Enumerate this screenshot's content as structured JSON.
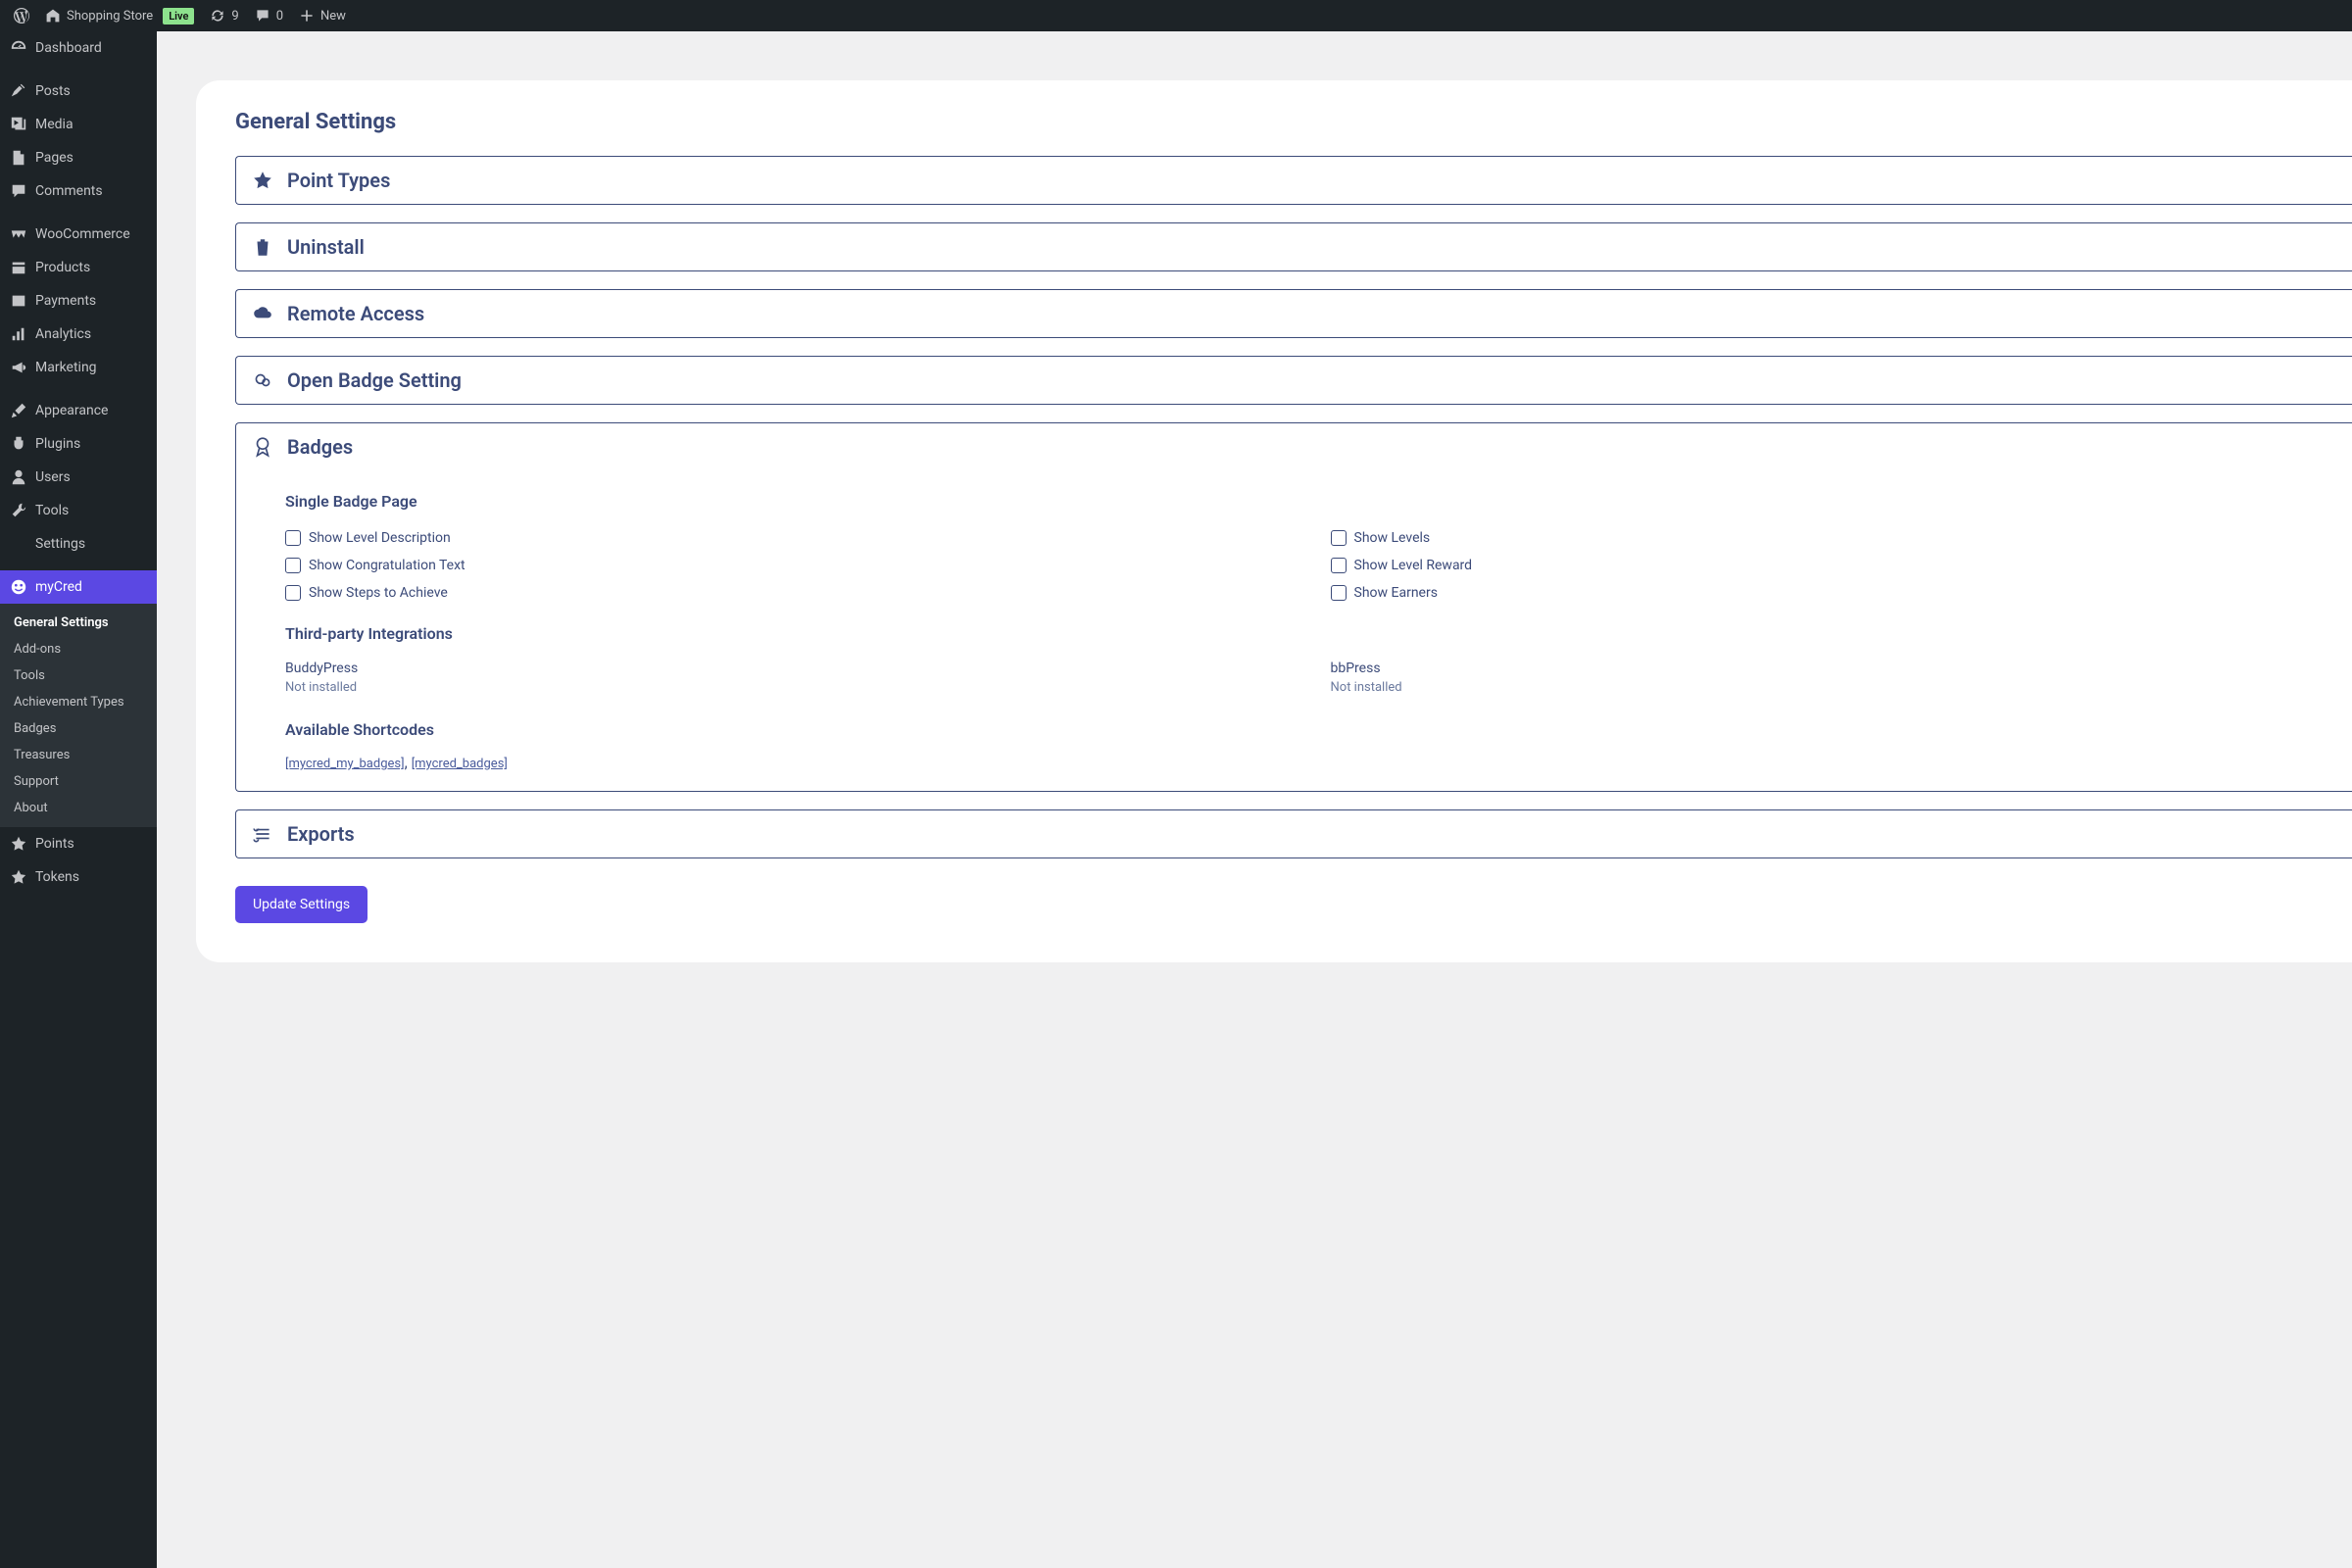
{
  "adminbar": {
    "site_name": "Shopping Store",
    "live_label": "Live",
    "updates": "9",
    "comments": "0",
    "new_label": "New"
  },
  "sidebar": {
    "items": [
      {
        "label": "Dashboard"
      },
      {
        "label": "Posts"
      },
      {
        "label": "Media"
      },
      {
        "label": "Pages"
      },
      {
        "label": "Comments"
      },
      {
        "label": "WooCommerce"
      },
      {
        "label": "Products"
      },
      {
        "label": "Payments"
      },
      {
        "label": "Analytics"
      },
      {
        "label": "Marketing"
      },
      {
        "label": "Appearance"
      },
      {
        "label": "Plugins"
      },
      {
        "label": "Users"
      },
      {
        "label": "Tools"
      },
      {
        "label": "Settings"
      },
      {
        "label": "myCred"
      },
      {
        "label": "Points"
      },
      {
        "label": "Tokens"
      }
    ],
    "submenu": [
      "General Settings",
      "Add-ons",
      "Tools",
      "Achievement Types",
      "Badges",
      "Treasures",
      "Support",
      "About"
    ]
  },
  "page": {
    "title": "General Settings",
    "update_button": "Update Settings",
    "accordions": {
      "point_types": "Point Types",
      "uninstall": "Uninstall",
      "remote_access": "Remote Access",
      "open_badge": "Open Badge Setting",
      "badges": "Badges",
      "exports": "Exports"
    },
    "badges_panel": {
      "single_badge_label": "Single Badge Page",
      "left": [
        "Show Level Description",
        "Show Congratulation Text",
        "Show Steps to Achieve"
      ],
      "right": [
        "Show Levels",
        "Show Level Reward",
        "Show Earners"
      ],
      "third_party_label": "Third-party Integrations",
      "buddypress": "BuddyPress",
      "bbpress": "bbPress",
      "not_installed": "Not installed",
      "shortcodes_label": "Available Shortcodes",
      "shortcode1": "[mycred_my_badges]",
      "shortcode2": "[mycred_badges]"
    }
  }
}
